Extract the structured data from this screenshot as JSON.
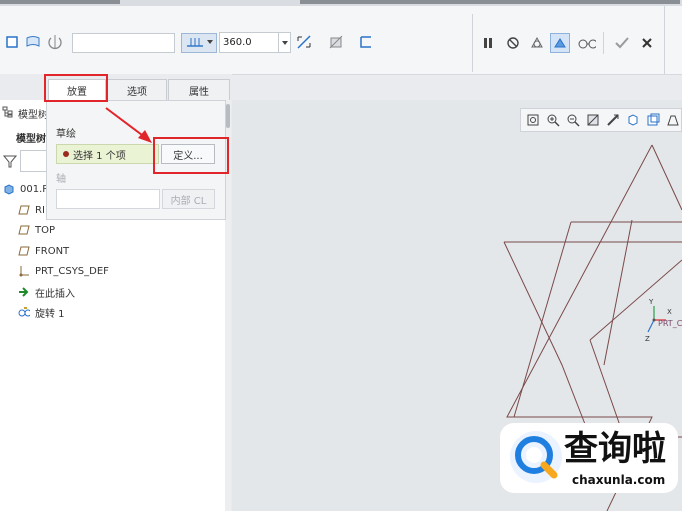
{
  "ribbon": {
    "angle_value": "360.0"
  },
  "tabs": [
    {
      "label": "放置"
    },
    {
      "label": "选项"
    },
    {
      "label": "属性"
    }
  ],
  "placement_panel": {
    "sketch_label": "草绘",
    "sketch_selector": "选择 1 个项",
    "define_button": "定义...",
    "axis_label": "轴",
    "internal_cl_button": "内部 CL"
  },
  "model_tree": {
    "header_truncated": "模型树",
    "subheader_truncated": "模型树",
    "root": "001.P",
    "items": [
      {
        "label": "RI",
        "icon": "datum-plane-icon"
      },
      {
        "label": "TOP",
        "icon": "datum-plane-icon"
      },
      {
        "label": "FRONT",
        "icon": "datum-plane-icon"
      },
      {
        "label": "PRT_CSYS_DEF",
        "icon": "csys-icon"
      },
      {
        "label": "在此插入",
        "icon": "insert-arrow-icon"
      },
      {
        "label": "旋转 1",
        "icon": "revolve-icon"
      }
    ]
  },
  "csys_labels": {
    "y": "Y",
    "x": "X",
    "z": "Z",
    "name": "PRT_C"
  },
  "watermark": {
    "brand": "查询啦",
    "url": "chaxunla.com"
  },
  "colors": {
    "highlight_red": "#e0252b",
    "sketch_line": "#7a4a4a",
    "selector_bg": "#eaf3d4"
  }
}
